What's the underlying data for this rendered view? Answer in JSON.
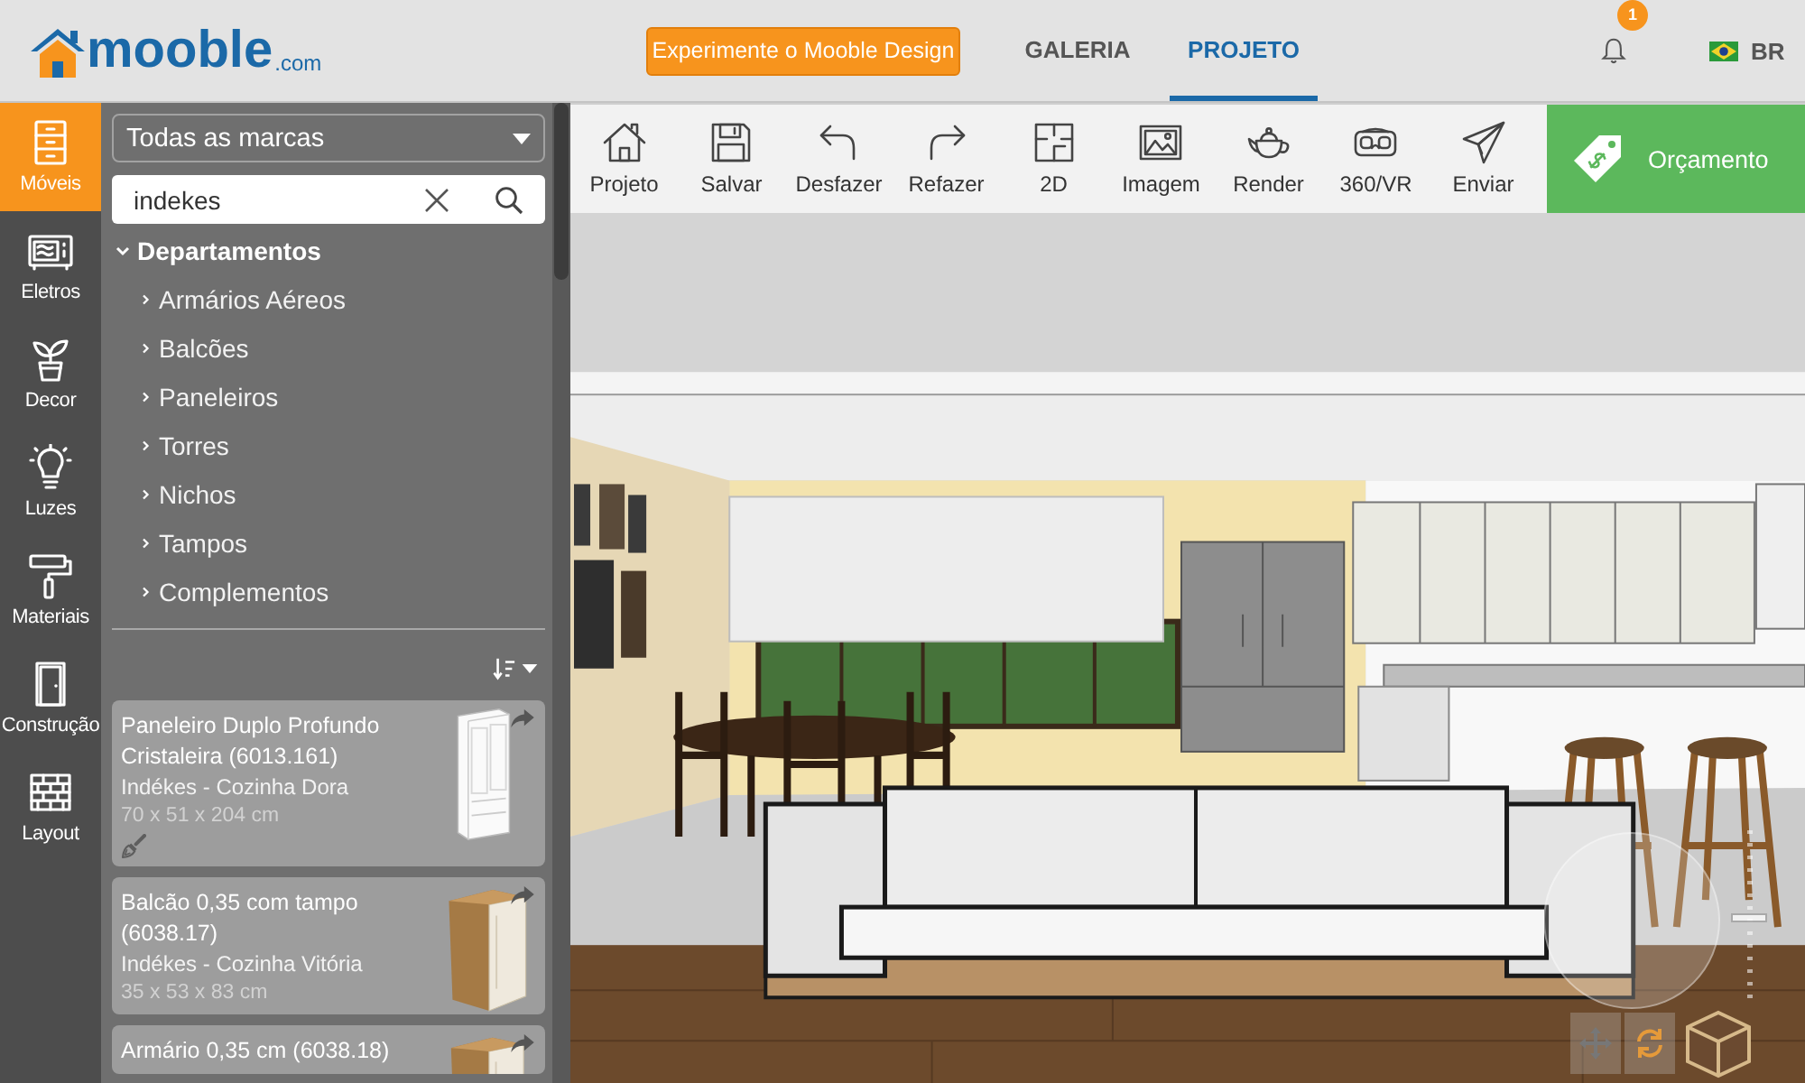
{
  "header": {
    "logo": {
      "wordmark": "mooble",
      "domain": ".com"
    },
    "promo_button": "Experimente o Mooble Design",
    "tabs": [
      {
        "label": "GALERIA",
        "selected": false
      },
      {
        "label": "PROJETO",
        "selected": true
      }
    ],
    "notification_count": "1",
    "language": "BR"
  },
  "rail": [
    {
      "label": "Móveis",
      "selected": true
    },
    {
      "label": "Eletros",
      "selected": false
    },
    {
      "label": "Decor",
      "selected": false
    },
    {
      "label": "Luzes",
      "selected": false
    },
    {
      "label": "Materiais",
      "selected": false
    },
    {
      "label": "Construção",
      "selected": false
    },
    {
      "label": "Layout",
      "selected": false
    }
  ],
  "catalog": {
    "brand_filter": "Todas as marcas",
    "search": {
      "value": "indekes"
    },
    "tree": [
      {
        "label": "Departamentos",
        "expanded": true,
        "children": [
          {
            "label": "Armários Aéreos",
            "expanded": false
          },
          {
            "label": "Balcões",
            "expanded": false
          },
          {
            "label": "Paneleiros",
            "expanded": false
          },
          {
            "label": "Torres",
            "expanded": false
          },
          {
            "label": "Nichos",
            "expanded": false
          },
          {
            "label": "Tampos",
            "expanded": false
          },
          {
            "label": "Complementos",
            "expanded": false
          }
        ]
      }
    ],
    "products": [
      {
        "title": "Paneleiro Duplo Profundo Cristaleira (6013.161)",
        "brand": "Indékes - Cozinha Dora",
        "dimensions": "70 x 51 x 204 cm",
        "customizable": true
      },
      {
        "title": "Balcão 0,35 com tampo (6038.17)",
        "brand": "Indékes - Cozinha Vitória",
        "dimensions": "35 x 53 x 83 cm",
        "customizable": false
      },
      {
        "title": "Armário 0,35 cm (6038.18)",
        "customizable": false
      }
    ]
  },
  "toolbar": {
    "buttons": [
      "Projeto",
      "Salvar",
      "Desfazer",
      "Refazer",
      "2D",
      "Imagem",
      "Render",
      "360/VR",
      "Enviar"
    ],
    "quote_button": "Orçamento"
  },
  "viewport": {
    "zoom": {
      "level": 0.5
    }
  }
}
